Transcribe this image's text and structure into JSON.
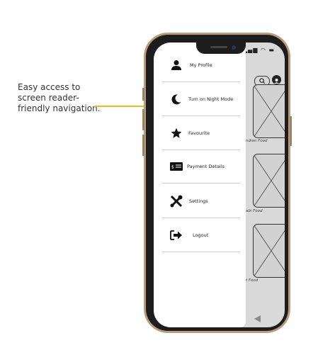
{
  "annotation": {
    "text": "Easy access to screen reader-friendly navigation.",
    "arrow_color": "#f3b81c"
  },
  "drawer": {
    "items": [
      {
        "label": "My Profile",
        "icon": "person-icon"
      },
      {
        "label": "Turn on Night Mode",
        "icon": "crescent-moon-icon"
      },
      {
        "label": "Favourite",
        "icon": "star-icon"
      },
      {
        "label": "Payment Details",
        "icon": "card-icon"
      },
      {
        "label": "Settings",
        "icon": "tools-icon"
      },
      {
        "label": "Logout",
        "icon": "logout-icon"
      }
    ]
  },
  "background_screen": {
    "cards": [
      {
        "label": "ndian Food"
      },
      {
        "label": "abi Food"
      },
      {
        "label": "t Food"
      }
    ]
  }
}
